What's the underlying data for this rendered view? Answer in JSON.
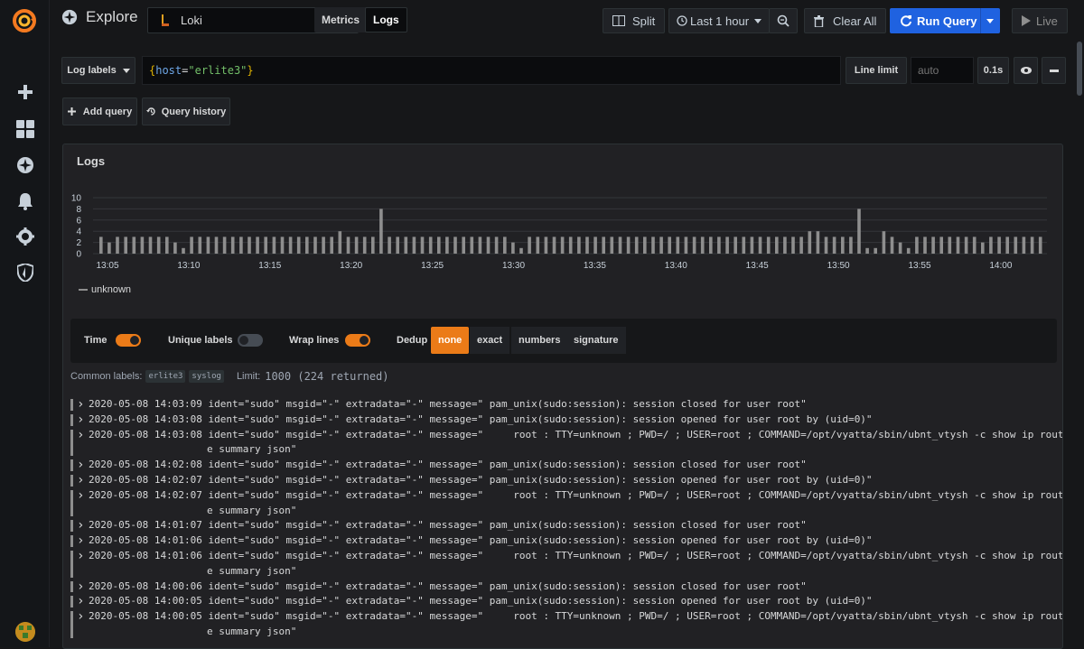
{
  "nav": {
    "items": [
      "plus-icon",
      "dashboards-icon",
      "explore-icon",
      "alerting-icon",
      "configuration-icon",
      "shield-icon"
    ]
  },
  "header": {
    "title": "Explore",
    "datasource": "Loki",
    "mode_metrics": "Metrics",
    "mode_logs": "Logs",
    "split": "Split",
    "time_range": "Last 1 hour",
    "clear_all": "Clear All",
    "run_query": "Run Query",
    "live": "Live"
  },
  "query": {
    "log_labels": "Log labels",
    "expression_open": "{",
    "expression_key": "host",
    "expression_eq": "=",
    "expression_value": "\"erlite3\"",
    "expression_close": "}",
    "line_limit_label": "Line limit",
    "line_limit_placeholder": "auto",
    "duration": "0.1s",
    "add_query": "Add query",
    "query_history": "Query history"
  },
  "panel": {
    "title": "Logs",
    "legend": "unknown"
  },
  "chart_data": {
    "type": "bar",
    "yticks": [
      "0",
      "2",
      "4",
      "6",
      "8",
      "10"
    ],
    "ylim": [
      0,
      10
    ],
    "xticks": [
      "13:05",
      "13:10",
      "13:15",
      "13:20",
      "13:25",
      "13:30",
      "13:35",
      "13:40",
      "13:45",
      "13:50",
      "13:55",
      "14:00"
    ],
    "series": [
      {
        "name": "unknown",
        "values": [
          3,
          2,
          3,
          3,
          3,
          3,
          3,
          3,
          3,
          2,
          1,
          3,
          3,
          3,
          3,
          3,
          3,
          3,
          3,
          3,
          3,
          3,
          3,
          3,
          3,
          3,
          3,
          3,
          3,
          4,
          3,
          3,
          3,
          3,
          8,
          3,
          3,
          3,
          3,
          3,
          3,
          3,
          3,
          3,
          3,
          3,
          3,
          3,
          3,
          3,
          2,
          1,
          3,
          3,
          3,
          3,
          3,
          3,
          3,
          3,
          3,
          3,
          3,
          3,
          3,
          3,
          3,
          3,
          3,
          3,
          3,
          3,
          3,
          3,
          3,
          3,
          3,
          3,
          3,
          3,
          3,
          3,
          3,
          3,
          3,
          3,
          4,
          4,
          3,
          3,
          3,
          3,
          8,
          1,
          1,
          4,
          3,
          2,
          1,
          3,
          3,
          3,
          3,
          3,
          3,
          3,
          3,
          2,
          3,
          3,
          3,
          3,
          3,
          3,
          3
        ]
      }
    ],
    "color": "#8e8e8e"
  },
  "options": {
    "time": "Time",
    "unique_labels": "Unique labels",
    "wrap_lines": "Wrap lines",
    "dedup": "Dedup",
    "dedup_options": [
      "none",
      "exact",
      "numbers",
      "signature"
    ],
    "dedup_selected": "none"
  },
  "common": {
    "label": "Common labels:",
    "labels": [
      "erlite3",
      "syslog"
    ],
    "limit_label": "Limit:",
    "limit_text": "1000 (224 returned)"
  },
  "logs": [
    {
      "text": "2020-05-08 14:03:09 ident=\"sudo\" msgid=\"-\" extradata=\"-\" message=\" pam_unix(sudo:session): session closed for user root\""
    },
    {
      "text": "2020-05-08 14:03:08 ident=\"sudo\" msgid=\"-\" extradata=\"-\" message=\" pam_unix(sudo:session): session opened for user root by (uid=0)\""
    },
    {
      "text": "2020-05-08 14:03:08 ident=\"sudo\" msgid=\"-\" extradata=\"-\" message=\"     root : TTY=unknown ; PWD=/ ; USER=root ; COMMAND=/opt/vyatta/sbin/ubnt_vtysh -c show ip rout",
      "cont": "e summary json\""
    },
    {
      "text": "2020-05-08 14:02:08 ident=\"sudo\" msgid=\"-\" extradata=\"-\" message=\" pam_unix(sudo:session): session closed for user root\""
    },
    {
      "text": "2020-05-08 14:02:07 ident=\"sudo\" msgid=\"-\" extradata=\"-\" message=\" pam_unix(sudo:session): session opened for user root by (uid=0)\""
    },
    {
      "text": "2020-05-08 14:02:07 ident=\"sudo\" msgid=\"-\" extradata=\"-\" message=\"     root : TTY=unknown ; PWD=/ ; USER=root ; COMMAND=/opt/vyatta/sbin/ubnt_vtysh -c show ip rout",
      "cont": "e summary json\""
    },
    {
      "text": "2020-05-08 14:01:07 ident=\"sudo\" msgid=\"-\" extradata=\"-\" message=\" pam_unix(sudo:session): session closed for user root\""
    },
    {
      "text": "2020-05-08 14:01:06 ident=\"sudo\" msgid=\"-\" extradata=\"-\" message=\" pam_unix(sudo:session): session opened for user root by (uid=0)\""
    },
    {
      "text": "2020-05-08 14:01:06 ident=\"sudo\" msgid=\"-\" extradata=\"-\" message=\"     root : TTY=unknown ; PWD=/ ; USER=root ; COMMAND=/opt/vyatta/sbin/ubnt_vtysh -c show ip rout",
      "cont": "e summary json\""
    },
    {
      "text": "2020-05-08 14:00:06 ident=\"sudo\" msgid=\"-\" extradata=\"-\" message=\" pam_unix(sudo:session): session closed for user root\""
    },
    {
      "text": "2020-05-08 14:00:05 ident=\"sudo\" msgid=\"-\" extradata=\"-\" message=\" pam_unix(sudo:session): session opened for user root by (uid=0)\""
    },
    {
      "text": "2020-05-08 14:00:05 ident=\"sudo\" msgid=\"-\" extradata=\"-\" message=\"     root : TTY=unknown ; PWD=/ ; USER=root ; COMMAND=/opt/vyatta/sbin/ubnt_vtysh -c show ip rout",
      "cont": "e summary json\""
    }
  ],
  "colors": {
    "accent": "#eb7b18",
    "primary": "#1f62e0",
    "query_key": "#d8d9da",
    "query_value": "#73bf69",
    "query_brace": "#e0b400"
  }
}
